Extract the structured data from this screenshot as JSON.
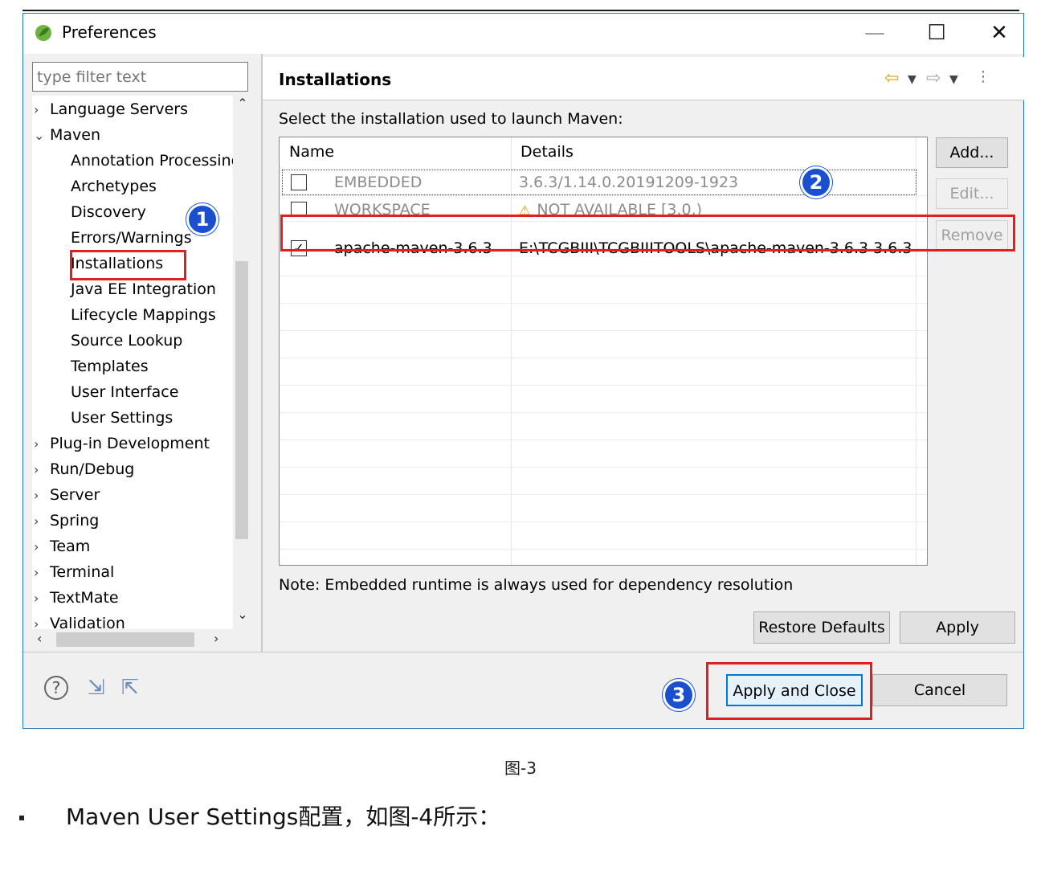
{
  "window": {
    "title": "Preferences",
    "min_glyph": "—",
    "max_glyph": "☐",
    "close_glyph": "✕"
  },
  "sidebar": {
    "filter_placeholder": "type filter text",
    "items": [
      {
        "label": "Language Servers",
        "toggle": "›"
      },
      {
        "label": "Maven",
        "toggle": "⌄"
      },
      {
        "label": "Annotation Processing",
        "toggle": ""
      },
      {
        "label": "Archetypes",
        "toggle": ""
      },
      {
        "label": "Discovery",
        "toggle": ""
      },
      {
        "label": "Errors/Warnings",
        "toggle": ""
      },
      {
        "label": "Installations",
        "toggle": ""
      },
      {
        "label": "Java EE Integration",
        "toggle": ""
      },
      {
        "label": "Lifecycle Mappings",
        "toggle": ""
      },
      {
        "label": "Source Lookup",
        "toggle": ""
      },
      {
        "label": "Templates",
        "toggle": ""
      },
      {
        "label": "User Interface",
        "toggle": ""
      },
      {
        "label": "User Settings",
        "toggle": ""
      },
      {
        "label": "Plug-in Development",
        "toggle": "›"
      },
      {
        "label": "Run/Debug",
        "toggle": "›"
      },
      {
        "label": "Server",
        "toggle": "›"
      },
      {
        "label": "Spring",
        "toggle": "›"
      },
      {
        "label": "Team",
        "toggle": "›"
      },
      {
        "label": "Terminal",
        "toggle": "›"
      },
      {
        "label": "TextMate",
        "toggle": "›"
      },
      {
        "label": "Validation",
        "toggle": "›"
      }
    ]
  },
  "page": {
    "title": "Installations",
    "select_label": "Select the installation used to launch Maven:",
    "columns": [
      "Name",
      "Details"
    ],
    "rows": [
      {
        "checked": false,
        "name": "EMBEDDED",
        "details": "3.6.3/1.14.0.20191209-1923",
        "warning": false,
        "dim": true
      },
      {
        "checked": false,
        "name": "WORKSPACE",
        "details": "NOT AVAILABLE [3.0,)",
        "warning": true,
        "dim": true
      },
      {
        "checked": true,
        "name": "apache-maven-3.6.3",
        "details": "E:\\TCGBIII\\TCGBIIITOOLS\\apache-maven-3.6.3 3.6.3",
        "warning": false,
        "dim": false
      }
    ],
    "add_label": "Add...",
    "edit_label": "Edit...",
    "remove_label": "Remove",
    "note": "Note: Embedded runtime is always used for dependency resolution",
    "restore_label": "Restore Defaults",
    "apply_label": "Apply"
  },
  "footer": {
    "apply_close_label": "Apply and Close",
    "cancel_label": "Cancel"
  },
  "badges": [
    "1",
    "2",
    "3"
  ],
  "caption": "图-3",
  "bullet_text": "Maven User Settings配置，如图-4所示：",
  "colors": {
    "highlight": "#e02020",
    "badge": "#1a50d0",
    "focus": "#0078d7"
  }
}
